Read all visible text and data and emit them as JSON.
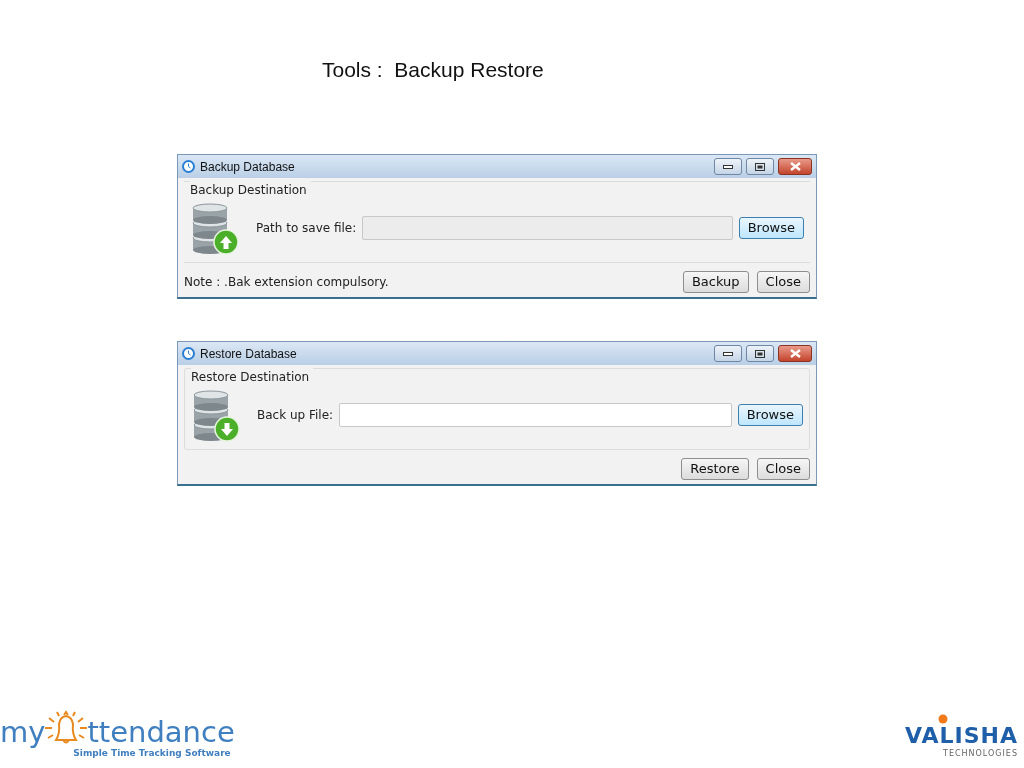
{
  "slide_title": "Tools :  Backup Restore",
  "windows": [
    {
      "title": "Backup Database",
      "kind": "backup",
      "group_label": "Backup Destination",
      "field_label": "Path to save file:",
      "field_disabled": true,
      "browse_label": "Browse",
      "note": "Note : .Bak extension compulsory.",
      "buttons": [
        "Backup",
        "Close"
      ]
    },
    {
      "title": "Restore Database",
      "kind": "restore",
      "group_label": "Restore Destination",
      "field_label": "Back up File:",
      "field_disabled": false,
      "browse_label": "Browse",
      "buttons": [
        "Restore",
        "Close"
      ]
    }
  ],
  "footer": {
    "left_logo": {
      "prefix": "my",
      "suffix": "ttendance",
      "tagline": "Simple Time Tracking Software"
    },
    "right_logo": {
      "name": "VALISHA",
      "sub": "TECHNOLOGIES"
    }
  }
}
